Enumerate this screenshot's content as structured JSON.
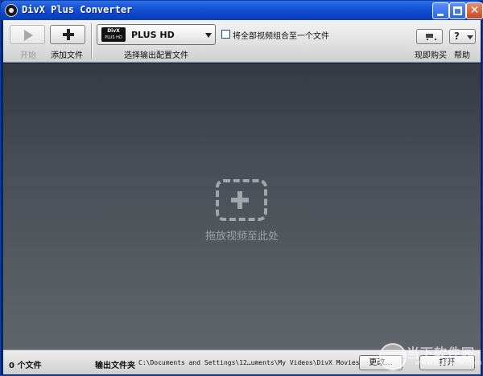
{
  "window": {
    "title": "DivX Plus Converter",
    "close_glyph": "✕"
  },
  "toolbar": {
    "start_label": "开始",
    "add_file_label": "添加文件",
    "profile_label": "选择输出配置文件",
    "profile": {
      "badge_line1": "DivX",
      "badge_line2": "PLUS HD",
      "value": "PLUS HD"
    },
    "combine_label": "将全部视频组合至一个文件",
    "combine_checked": false,
    "buy_label": "现即购买",
    "help_label": "帮助",
    "help_glyph": "?"
  },
  "drop_area": {
    "hint": "拖放视频至此处",
    "icon": "dashed-plus-icon"
  },
  "status": {
    "file_count": "0 个文件",
    "output_folder_label": "输出文件夹",
    "output_path": "C:\\Documents and Settings\\12…uments\\My Videos\\DivX Movies",
    "change_label": "更改...",
    "open_label": "打开"
  },
  "watermark": {
    "text": "当下软件园",
    "url": "www.downxia.com"
  },
  "colors": {
    "titlebar": "#0b46c8",
    "drop_top": "#353942",
    "drop_bottom": "#60646b"
  }
}
